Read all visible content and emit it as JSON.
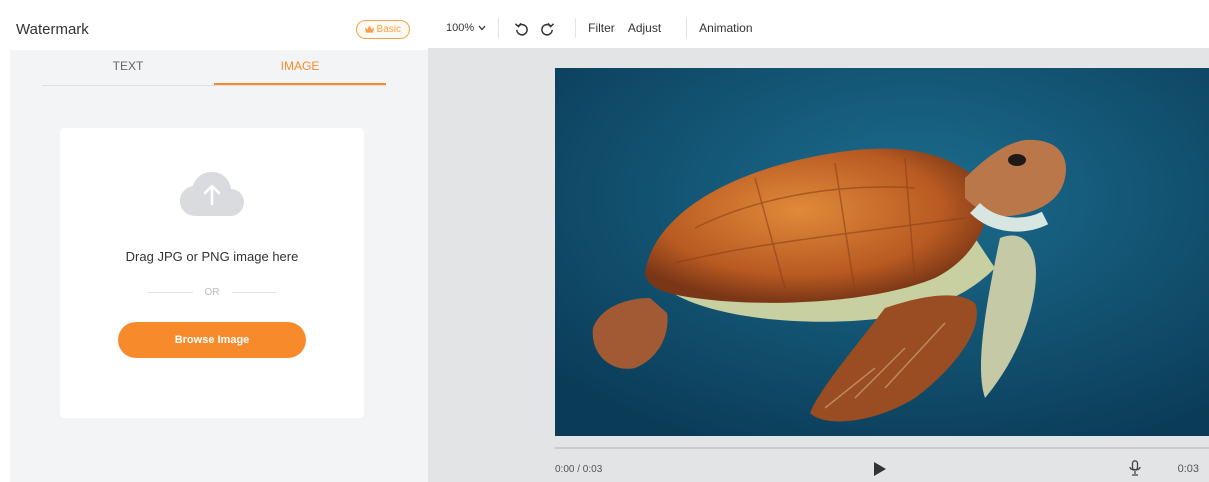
{
  "panel": {
    "title": "Watermark",
    "badge": "Basic",
    "badge_icon": "crown-icon",
    "tabs": [
      {
        "label": "TEXT",
        "active": false
      },
      {
        "label": "IMAGE",
        "active": true
      }
    ],
    "upload": {
      "icon": "cloud-upload-icon",
      "drag_text": "Drag JPG or PNG image here",
      "or_text": "OR",
      "browse_label": "Browse Image"
    }
  },
  "toolbar": {
    "zoom": "100%",
    "undo_icon": "undo-icon",
    "redo_icon": "redo-icon",
    "items": [
      "Filter",
      "Adjust",
      "Animation"
    ]
  },
  "player": {
    "time": "0:00 / 0:03",
    "duration": "0:03",
    "play_icon": "play-icon",
    "mic_icon": "microphone-icon",
    "progress": 0
  },
  "colors": {
    "accent": "#f78a2b",
    "panel_bg": "#f3f4f6",
    "stage_bg": "#e3e4e6",
    "preview_bg": "#0f4d6c"
  }
}
